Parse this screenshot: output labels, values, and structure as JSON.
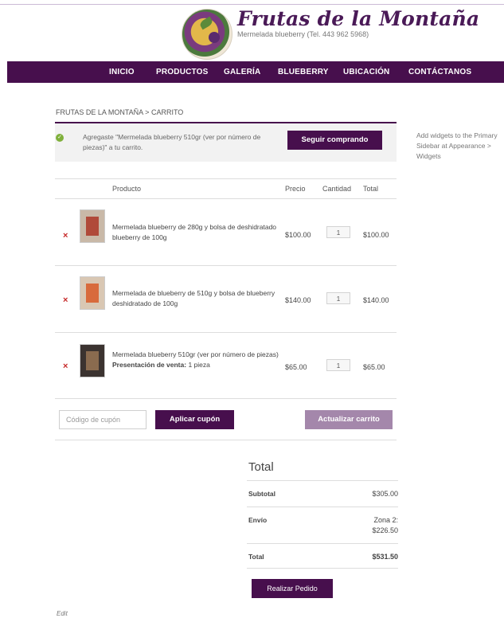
{
  "site": {
    "title": "Frutas de la Montaña",
    "subtitle": "Mermelada blueberry (Tel. 443 962 5968)"
  },
  "nav": {
    "items": [
      "INICIO",
      "PRODUCTOS",
      "GALERÍA",
      "BLUEBERRY",
      "UBICACIÓN",
      "CONTÁCTANOS"
    ]
  },
  "breadcrumb": "FRUTAS DE LA MONTAÑA > CARRITO",
  "notice": {
    "message": "Agregaste \"Mermelada blueberry 510gr (ver por número de piezas)\" a tu carrito.",
    "button": "Seguir comprando"
  },
  "sidebar": {
    "text": "Add widgets to the Primary Sidebar at Appearance > Widgets"
  },
  "cart": {
    "headers": {
      "product": "Producto",
      "price": "Precio",
      "quantity": "Cantidad",
      "total": "Total"
    },
    "items": [
      {
        "name": "Mermelada blueberry de 280g y bolsa de deshidratado blueberry de 100g",
        "meta_label": "",
        "meta_value": "",
        "price": "$100.00",
        "quantity": "1",
        "subtotal": "$100.00",
        "remove": "×"
      },
      {
        "name": "Mermelada de blueberry de 510g y bolsa de blueberry deshidratado de 100g",
        "meta_label": "",
        "meta_value": "",
        "price": "$140.00",
        "quantity": "1",
        "subtotal": "$140.00",
        "remove": "×"
      },
      {
        "name": "Mermelada blueberry 510gr (ver por número de piezas)",
        "meta_label": "Presentación de venta:",
        "meta_value": "1 pieza",
        "price": "$65.00",
        "quantity": "1",
        "subtotal": "$65.00",
        "remove": "×"
      }
    ],
    "coupon_placeholder": "Código de cupón",
    "apply_coupon": "Aplicar cupón",
    "update_cart": "Actualizar carrito"
  },
  "totals": {
    "title": "Total",
    "subtotal_label": "Subtotal",
    "subtotal_value": "$305.00",
    "shipping_label": "Envío",
    "shipping_zone": "Zona 2:",
    "shipping_value": "$226.50",
    "total_label": "Total",
    "total_value": "$531.50",
    "checkout": "Realizar Pedido"
  },
  "edit_link": "Edit",
  "colors": {
    "brand_purple": "#470f4d",
    "update_button": "#a487ab",
    "remove_red": "#c62828",
    "success_green": "#7fb03b"
  },
  "icons": {
    "remove": "close-icon",
    "notice": "check-icon"
  }
}
